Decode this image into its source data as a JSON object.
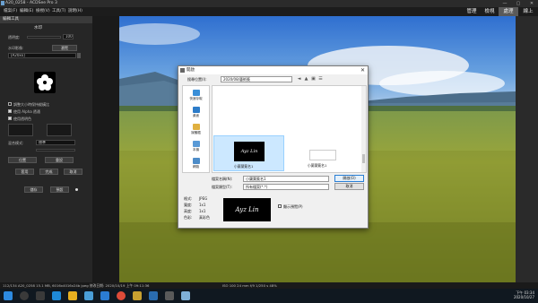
{
  "window": {
    "title": "A20_0258 - ACDSee Pro 3",
    "controls": [
      "—",
      "▢",
      "✕"
    ]
  },
  "menu": {
    "items": [
      "檔案(F)",
      "編輯(E)",
      "檢視(V)",
      "工具(T)",
      "說明(H)"
    ],
    "modes": [
      {
        "label": "管理",
        "active": false
      },
      {
        "label": "檢視",
        "active": false
      },
      {
        "label": "處理",
        "active": true
      },
      {
        "label": "線上",
        "active": false
      }
    ]
  },
  "panel": {
    "header": "編輯工具",
    "section_title": "水印",
    "opacity_label": "透明度:",
    "opacity_value": "100",
    "image_label": "水印影像:",
    "browse_button": "瀏覽",
    "file_value": "[A20xx]",
    "checkbox1": "調整大小時保持縱橫比",
    "checkbox2": "使用 Alpha 透通",
    "checkbox3": "使用透明色",
    "blend_label": "混合模式:",
    "blend_value": "標準",
    "position_label": "位置",
    "btn_done": "完成",
    "btn_cancel": "取消",
    "btn_apply": "套用",
    "btn_reset": "重設",
    "btn_save": "儲存",
    "btn_default": "預設"
  },
  "dialog": {
    "title": "開啟",
    "look_in_label": "搜尋位置(I):",
    "look_in_value": "2020/08/藝術簽",
    "sidebar": [
      {
        "label": "快速存取",
        "color": "#3a8fd8"
      },
      {
        "label": "桌面",
        "color": "#2d7cc9"
      },
      {
        "label": "媒體櫃",
        "color": "#e0b040"
      },
      {
        "label": "本機",
        "color": "#5a9ad6"
      },
      {
        "label": "網路",
        "color": "#4d8cc8"
      }
    ],
    "files": [
      {
        "name": "小蘭葉簽名1",
        "selected": true,
        "sig": "Ayz Lin"
      },
      {
        "name": "小蘭葉簽名1",
        "selected": false,
        "sig": ""
      }
    ],
    "filename_label": "檔案名稱(N):",
    "filename_value": "小蘭葉簽名1",
    "filetype_label": "檔案類型(T):",
    "filetype_value": "所有檔案(*.*)",
    "open_button": "開啟(O)",
    "cancel_button": "取消",
    "info": {
      "format_label": "格式:",
      "format_value": "JPEG",
      "width_label": "寬度:",
      "width_value": "1x1",
      "height_label": "高度:",
      "height_value": "1x1",
      "color_label": "色彩:",
      "color_value": "真彩色"
    },
    "preview_sig": "Ayz Lin",
    "preview_checkbox": "顯示預覽(P)"
  },
  "status": {
    "left": "112/134  A20_0258  15.1 MB, 6016x4016x24b jpeg  修改日期: 2020/10/19 上午 09:11:36",
    "mid": "ISO 100  24 mm  f/9  1/250 s  48%"
  },
  "taskbar": {
    "time": "下午 03:34",
    "date": "2020/10/27"
  }
}
